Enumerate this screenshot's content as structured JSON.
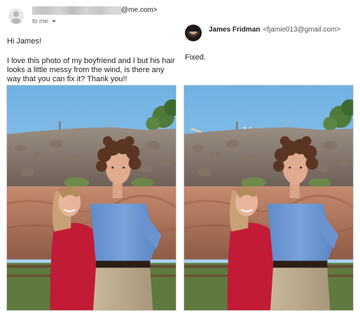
{
  "original_email": {
    "sender_domain": "@me.com>",
    "recipient_line": "to me",
    "greeting": "Hi James!",
    "body": "I love this photo of my boyfriend and I but his hair looks a little messy from the wind, is there any way that you can fix it? Thank you!!"
  },
  "reply": {
    "name": "James Fridman",
    "email": "<fjamie013@gmail.com>",
    "body": "Fixed."
  },
  "icons": {
    "sender_avatar": "person-placeholder-icon",
    "recipient_dropdown": "chevron-down-icon",
    "reply_avatar": "profile-photo"
  },
  "colors": {
    "sky": "#8fc3e8",
    "shirt_blue": "#6a93d0",
    "dress_red": "#c41e3a"
  }
}
